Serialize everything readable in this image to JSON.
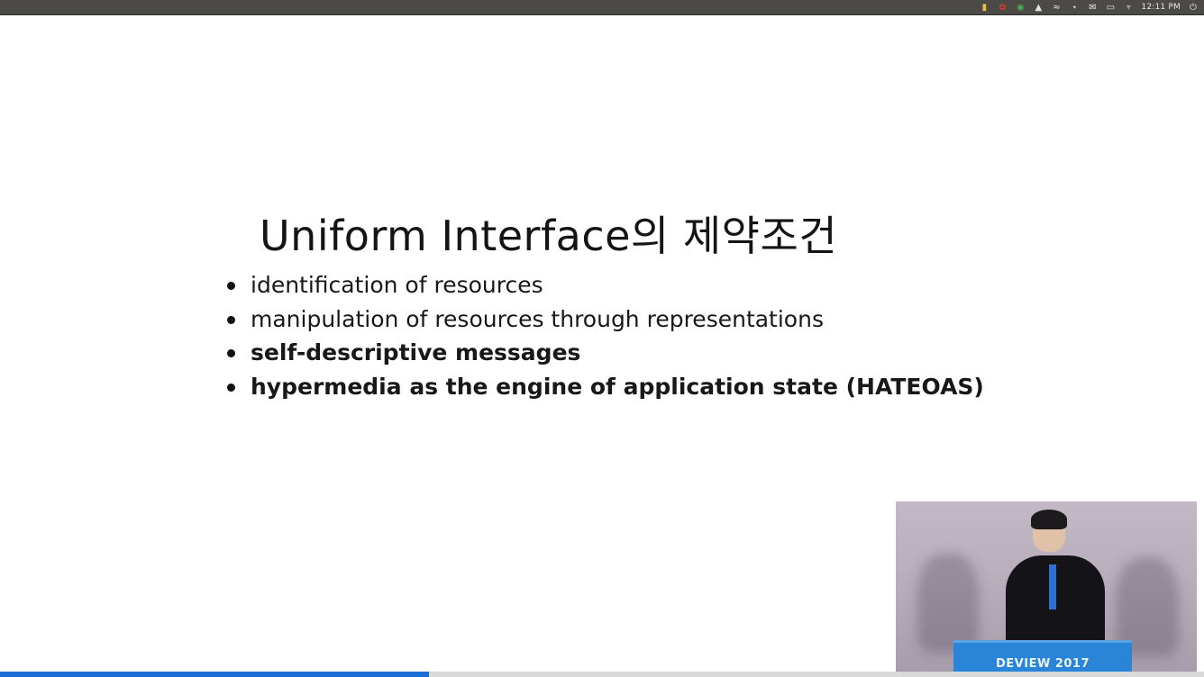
{
  "system_tray": {
    "time": "12:11 PM",
    "icons": [
      "shield-icon",
      "gift-icon",
      "chrome-icon",
      "upload-icon",
      "wifi-icon",
      "bluetooth-icon",
      "mail-icon",
      "battery-icon",
      "volume-mute-icon",
      "power-icon"
    ]
  },
  "slide": {
    "title": "Uniform Interface의 제약조건",
    "bullets": [
      {
        "text": "identification of resources",
        "bold": false
      },
      {
        "text": "manipulation of resources through representations",
        "bold": false
      },
      {
        "text": "self-descriptive messages",
        "bold": true
      },
      {
        "text": "hypermedia as the engine of application state (HATEOAS)",
        "bold": true
      }
    ]
  },
  "video_inset": {
    "podium_label": "DEVIEW 2017"
  },
  "playback": {
    "progress": 0.356,
    "progress_color": "#1d6fd8"
  }
}
